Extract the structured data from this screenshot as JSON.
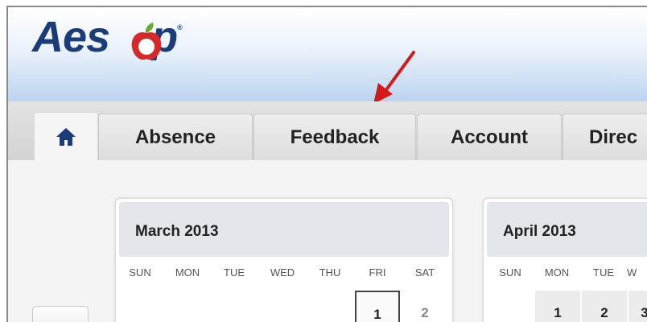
{
  "brand": {
    "name": "Aes",
    "name_tail": "p",
    "trademark": "®"
  },
  "tabs": [
    {
      "label": "",
      "icon": "home-icon"
    },
    {
      "label": "Absence"
    },
    {
      "label": "Feedback"
    },
    {
      "label": "Account"
    },
    {
      "label": "Direc"
    }
  ],
  "calendars": [
    {
      "title": "March 2013",
      "weekdays": [
        "SUN",
        "MON",
        "TUE",
        "WED",
        "THU",
        "FRI",
        "SAT"
      ],
      "first_dates": [
        "1",
        "2"
      ]
    },
    {
      "title": "April 2013",
      "weekdays": [
        "SUN",
        "MON",
        "TUE",
        "W"
      ],
      "first_dates": [
        "1",
        "2",
        "3"
      ]
    }
  ],
  "colors": {
    "brand_blue": "#1a3d79",
    "accent_red": "#d62a2a",
    "leaf_green": "#6aab2b",
    "arrow_red": "#d11b1b"
  }
}
